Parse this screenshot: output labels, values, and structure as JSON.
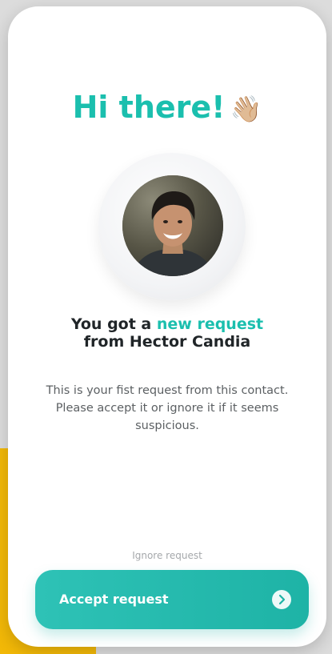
{
  "greeting": {
    "title": "Hi there!",
    "emoji": "👋🏼"
  },
  "request": {
    "headline_prefix": "You got a",
    "headline_accent": "new request",
    "headline_from": "from Hector Candia",
    "message": "This is your fist request from this contact. Please accept it or ignore it if it seems suspicious."
  },
  "actions": {
    "ignore_label": "Ignore request",
    "accept_label": "Accept request"
  },
  "colors": {
    "accent": "#1bbfae",
    "text_dark": "#202528",
    "text_muted": "#5c6063",
    "link_muted": "#a5a8ab",
    "background_yellow": "#f2b807"
  },
  "icons": {
    "wave": "waving-hand-icon",
    "accept_arrow": "chevron-right-circle-icon"
  }
}
